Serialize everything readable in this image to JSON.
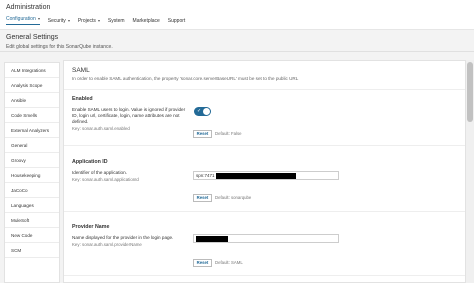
{
  "app": {
    "title": "Administration"
  },
  "nav": [
    {
      "label": "Configuration",
      "dropdown": true,
      "active": true
    },
    {
      "label": "Security",
      "dropdown": true
    },
    {
      "label": "Projects",
      "dropdown": true
    },
    {
      "label": "System",
      "dropdown": false
    },
    {
      "label": "Marketplace",
      "dropdown": false
    },
    {
      "label": "Support",
      "dropdown": false
    }
  ],
  "header": {
    "title": "General Settings",
    "subtitle": "Edit global settings for this SonarQube instance."
  },
  "sidebar": {
    "items": [
      {
        "label": "ALM Integrations"
      },
      {
        "label": "Analysis Scope"
      },
      {
        "label": "Ansible"
      },
      {
        "label": "Code Smells"
      },
      {
        "label": "External Analyzers"
      },
      {
        "label": "General"
      },
      {
        "label": "Groovy"
      },
      {
        "label": "Housekeeping"
      },
      {
        "label": "JaCoCo"
      },
      {
        "label": "Languages"
      },
      {
        "label": "MuleSoft"
      },
      {
        "label": "New Code"
      },
      {
        "label": "SCM"
      }
    ]
  },
  "saml": {
    "title": "SAML",
    "description": "In order to enable SAML authentication, the property 'sonar.core.serverBaseURL' must be set to the public URL"
  },
  "enabled": {
    "title": "Enabled",
    "description": "Enable SAML users to login. Value is ignored if provider ID, login url, certificate, login, name attributes are not defined.",
    "key": "Key: sonar.auth.saml.enabled",
    "value": true,
    "reset_label": "Reset",
    "default": "Default: False"
  },
  "application_id": {
    "title": "Application ID",
    "description": "Identifier of the application.",
    "key": "Key: sonar.auth.saml.applicationId",
    "value": "spn:7471",
    "reset_label": "Reset",
    "default": "Default: sonarqube"
  },
  "provider_name": {
    "title": "Provider Name",
    "description": "Name displayed for the provider in the login page.",
    "key": "Key: sonar.auth.saml.providerName",
    "reset_label": "Reset",
    "default": "Default: SAML"
  },
  "colors": {
    "accent": "#236a97",
    "toggle": "#236a97"
  }
}
